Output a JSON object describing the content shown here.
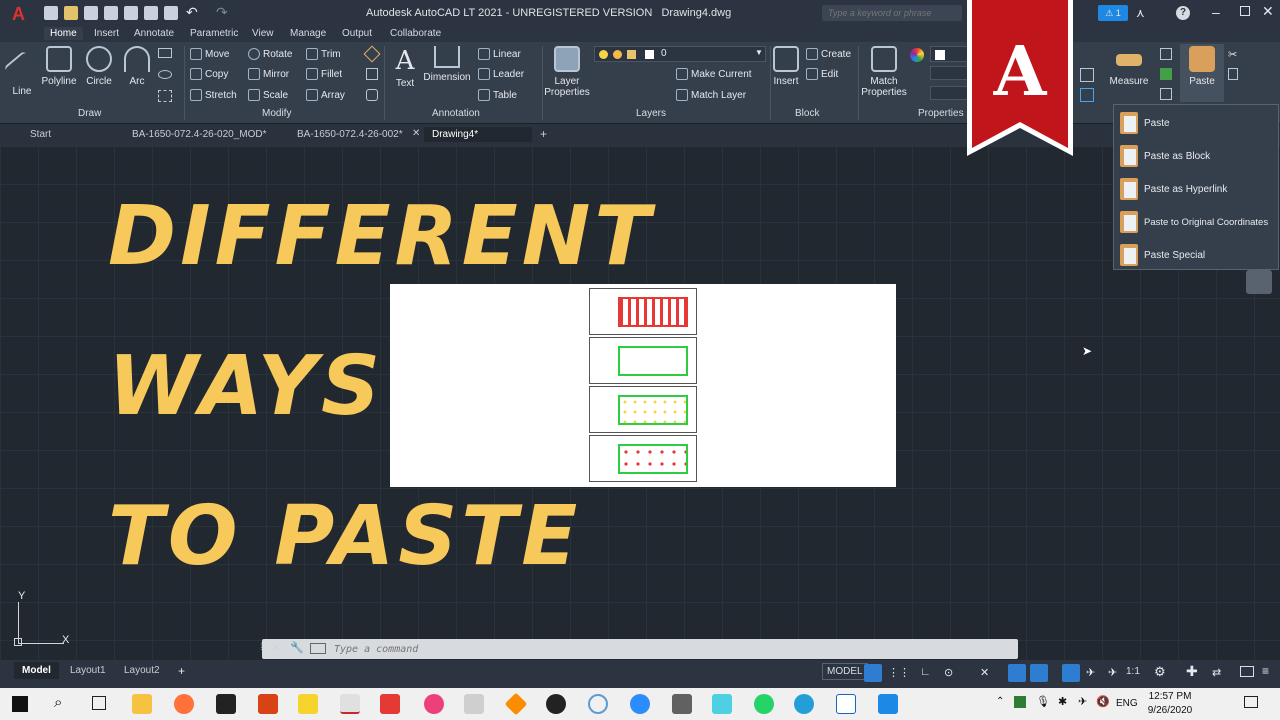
{
  "app_title": "Autodesk AutoCAD LT 2021 - UNREGISTERED VERSION",
  "drawing_name": "Drawing4.dwg",
  "search_placeholder": "Type a keyword or phrase",
  "notification_count": "1",
  "ribbon_tabs": [
    "Home",
    "Insert",
    "Annotate",
    "Parametric",
    "View",
    "Manage",
    "Output",
    "Collaborate"
  ],
  "draw": {
    "line": "Line",
    "polyline": "Polyline",
    "circle": "Circle",
    "arc": "Arc",
    "label": "Draw"
  },
  "modify": {
    "move": "Move",
    "rotate": "Rotate",
    "trim": "Trim",
    "copy": "Copy",
    "mirror": "Mirror",
    "fillet": "Fillet",
    "stretch": "Stretch",
    "scale": "Scale",
    "array": "Array",
    "label": "Modify"
  },
  "annotation": {
    "text": "Text",
    "dimension": "Dimension",
    "linear": "Linear",
    "leader": "Leader",
    "table": "Table",
    "label": "Annotation"
  },
  "layers": {
    "layer_properties": "Layer Properties",
    "current_layer": "0",
    "make_current": "Make Current",
    "match_layer": "Match Layer",
    "label": "Layers"
  },
  "block": {
    "insert": "Insert",
    "create": "Create",
    "edit": "Edit",
    "label": "Block"
  },
  "properties": {
    "match": "Match Properties",
    "label": "Properties"
  },
  "utilities": {
    "measure": "Measure"
  },
  "clipboard": {
    "paste": "Paste"
  },
  "doc_tabs": [
    "Start",
    "BA-1650-072.4-26-020_MOD*",
    "BA-1650-072.4-26-002*",
    "Drawing4*"
  ],
  "overlay_text": [
    "DIFFERENT",
    "WAYS",
    "TO PASTE"
  ],
  "paste_menu": [
    "Paste",
    "Paste as Block",
    "Paste as Hyperlink",
    "Paste to Original Coordinates",
    "Paste Special"
  ],
  "command_placeholder": "Type a command",
  "ucs": {
    "x": "X",
    "y": "Y"
  },
  "layout_tabs": [
    "Model",
    "Layout1",
    "Layout2"
  ],
  "status": {
    "model": "MODEL",
    "scale": "1:1"
  },
  "clock": {
    "time": "12:57 PM",
    "date": "9/26/2020"
  },
  "language": "ENG",
  "colors": {
    "accent": "#f7c85a",
    "logo_red": "#c0151b",
    "ribbon": "#353f4c",
    "canvas": "#212830"
  }
}
